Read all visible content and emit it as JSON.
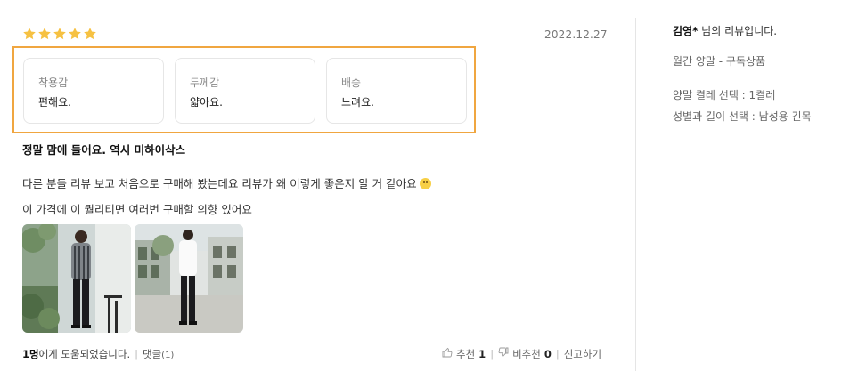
{
  "rating": {
    "stars": 5,
    "star_icon": "star-icon",
    "star_color": "#f6c142"
  },
  "date": "2022.12.27",
  "attributes": [
    {
      "label": "착용감",
      "value": "편해요."
    },
    {
      "label": "두께감",
      "value": "얇아요."
    },
    {
      "label": "배송",
      "value": "느려요."
    }
  ],
  "highlight_color": "#f0a640",
  "headline": "정말 맘에 들어요. 역시 미하이삭스",
  "body": {
    "line1": "다른 분들 리뷰 보고 처음으로 구매해 봤는데요 리뷰가 왜 이렇게 좋은지 알 거 같아요",
    "line2": "이 가격에 이 퀄리티면 여러번 구매할 의향 있어요"
  },
  "footer": {
    "helpful_count": "1명",
    "helpful_text": "에게 도움되었습니다.",
    "reply_label": "댓글",
    "reply_count": "(1)",
    "recommend_label": "추천",
    "recommend_count": "1",
    "not_recommend_label": "비추천",
    "not_recommend_count": "0",
    "report_label": "신고하기"
  },
  "reviewer": {
    "name": "김영*",
    "suffix": " 님의 리뷰입니다.",
    "product": "월간 양말 - 구독상품",
    "option1": "양말 켤레 선택 : 1켤레",
    "option2": "성별과 길이 선택 : 남성용 긴목"
  }
}
